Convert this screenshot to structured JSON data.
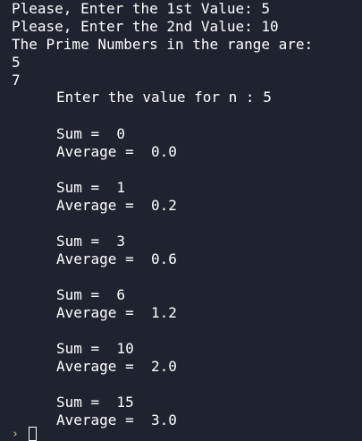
{
  "terminal": {
    "lines": {
      "l0": "Please, Enter the 1st Value: 5",
      "l1": "Please, Enter the 2nd Value: 10",
      "l2": "The Prime Numbers in the range are:",
      "l3": "5",
      "l4": "7",
      "l5": "Enter the value for n : 5",
      "s0": "Sum =  0",
      "a0": "Average =  0.0",
      "s1": "Sum =  1",
      "a1": "Average =  0.2",
      "s2": "Sum =  3",
      "a2": "Average =  0.6",
      "s3": "Sum =  6",
      "a3": "Average =  1.2",
      "s4": "Sum =  10",
      "a4": "Average =  2.0",
      "s5": "Sum =  15",
      "a5": "Average =  3.0"
    },
    "prompt_glyph": "›",
    "colors": {
      "background": "#1f2330",
      "text": "#ffffff",
      "prompt": "#e5c07b"
    }
  }
}
